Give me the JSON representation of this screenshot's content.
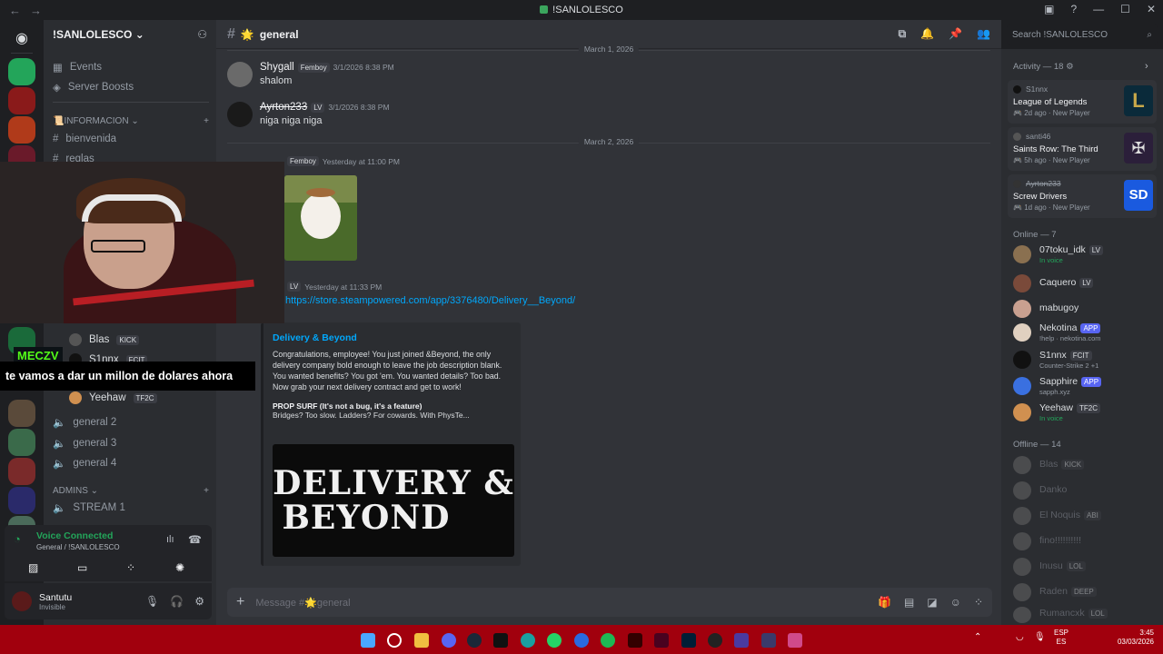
{
  "window": {
    "title": "!SANLOLESCO"
  },
  "server": {
    "name": "!SANLOLESCO",
    "menu_items": [
      "Events",
      "Server Boosts"
    ],
    "categories": [
      {
        "name": "INFORMACION",
        "channels": [
          "bienvenida",
          "reglas"
        ]
      },
      {
        "name": "ADMINS",
        "channels": [
          "STREAM 1"
        ]
      }
    ],
    "voice_channels": [
      "general 2",
      "general 3",
      "general 4"
    ],
    "voice_members": [
      {
        "name": "Blas",
        "tag": "KICK"
      },
      {
        "name": "S1nnx",
        "tag": "FCIT"
      },
      {
        "name": "Yeehaw",
        "tag": "TF2C"
      }
    ]
  },
  "voice": {
    "status": "Voice Connected",
    "location": "General / !SANLOLESCO"
  },
  "user": {
    "name": "Santutu",
    "status": "Invisible"
  },
  "channel": {
    "name": "general"
  },
  "search": {
    "placeholder": "Search !SANLOLESCO"
  },
  "messages": {
    "divider_top": "March 1, 2026",
    "divider_mid": "March 2, 2026",
    "m1": {
      "author": "Shygall",
      "tag": "Femboy",
      "time": "3/1/2026 8:38 PM",
      "text": "shalom"
    },
    "m2": {
      "author": "Ayrton233",
      "tag": "LV",
      "time": "3/1/2026 8:38 PM",
      "text": "niga niga niga"
    },
    "m3": {
      "author": "Shygall",
      "tag": "Femboy",
      "time": "Yesterday at 11:00 PM"
    },
    "m4": {
      "tag": "LV",
      "time": "Yesterday at 11:33 PM",
      "link": "https://store.steampowered.com/app/3376480/Delivery__Beyond/"
    }
  },
  "embed": {
    "title": "Delivery & Beyond",
    "description": "Congratulations, employee! You just joined &Beyond, the only delivery company bold enough to leave the job description blank. You wanted benefits? You got 'em. You wanted details? Too bad. Now grab your next delivery contract and get to work!",
    "subtitle": "PROP SURF (It's not a bug, it's a feature)",
    "subtext": "Bridges? Too slow. Ladders? For cowards. With PhysTe...",
    "banner_line1": "DELIVERY &",
    "banner_line2": "BEYOND"
  },
  "composer": {
    "placeholder": "Message #🌟general"
  },
  "activity": {
    "header": "Activity — 18",
    "items": [
      {
        "user": "S1nnx",
        "game": "League of Legends",
        "meta": "2d ago",
        "badge": "New Player",
        "art_color": "#0a2a3a"
      },
      {
        "user": "santi46",
        "game": "Saints Row: The Third",
        "meta": "5h ago",
        "badge": "New Player",
        "art_color": "#2b1f3a"
      },
      {
        "user": "Ayrton233",
        "game": "Screw Drivers",
        "meta": "1d ago",
        "badge": "New Player",
        "art_color": "#1a5adf"
      }
    ]
  },
  "online": {
    "header": "Online — 7",
    "members": [
      {
        "name": "07toku_idk",
        "tag": "LV",
        "status": "In voice",
        "color": "#8a7050"
      },
      {
        "name": "Caquero",
        "tag": "LV",
        "status": "",
        "color": "#7a4a3a"
      },
      {
        "name": "mabugoy",
        "tag": "",
        "status": "",
        "color": "#c9a090"
      },
      {
        "name": "Nekotina",
        "tag": "APP",
        "status": "!help · nekotina.com",
        "color": "#e0d0c0"
      },
      {
        "name": "S1nnx",
        "tag": "FCIT",
        "status": "Counter-Strike 2 +1",
        "color": "#111111"
      },
      {
        "name": "Sapphire",
        "tag": "APP",
        "status": "sapph.xyz",
        "color": "#3a70e0"
      },
      {
        "name": "Yeehaw",
        "tag": "TF2C",
        "status": "In voice",
        "color": "#d09050"
      }
    ]
  },
  "offline": {
    "header": "Offline — 14",
    "members": [
      {
        "name": "Blas",
        "tag": "KICK"
      },
      {
        "name": "Danko",
        "tag": ""
      },
      {
        "name": "El Noquis",
        "tag": "ABI"
      },
      {
        "name": "fino!!!!!!!!!!",
        "tag": ""
      },
      {
        "name": "Inusu",
        "tag": "LOL"
      },
      {
        "name": "Raden",
        "tag": "DEEP"
      },
      {
        "name": "Rumancxk",
        "tag": "LOL"
      }
    ]
  },
  "overlay": {
    "streamer": "MECZV",
    "caption": "te vamos a dar un millon de dolares ahora"
  },
  "taskbar": {
    "lang1": "ESP",
    "lang2": "ES",
    "time": "3:45",
    "date": "03/03/2026"
  },
  "colors": {
    "accent": "#5865f2",
    "taskbar": "#a1000d",
    "online": "#23a55a"
  }
}
